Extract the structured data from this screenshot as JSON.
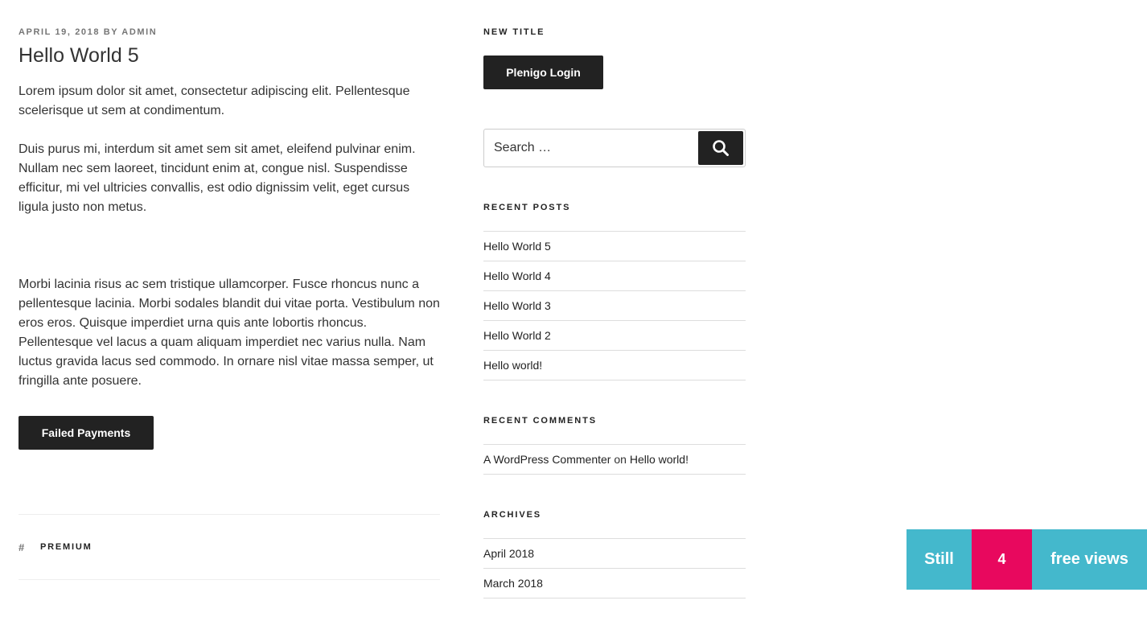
{
  "post": {
    "date": "APRIL 19, 2018",
    "by": "BY",
    "author": "ADMIN",
    "title": "Hello World 5",
    "paragraphs": [
      "Lorem ipsum dolor sit amet, consectetur adipiscing elit. Pellentesque scelerisque ut sem at condimentum.",
      "Duis purus mi, interdum sit amet sem sit amet, eleifend pulvinar enim. Nullam nec sem laoreet, tincidunt enim at, congue nisl. Suspendisse efficitur, mi vel ultricies convallis, est odio dignissim velit, eget cursus ligula justo non metus.",
      "Morbi lacinia risus ac sem tristique ullamcorper. Fusce rhoncus nunc a pellentesque lacinia. Morbi sodales blandit dui vitae porta. Vestibulum non eros eros. Quisque imperdiet urna quis ante lobortis rhoncus. Pellentesque vel lacus a quam aliquam imperdiet nec varius nulla. Nam luctus gravida lacus sed commodo. In ornare nisl vitae massa semper, ut fringilla ante posuere."
    ],
    "failed_payments_label": "Failed Payments",
    "tag_symbol": "#",
    "tag": "PREMIUM"
  },
  "sidebar": {
    "new_title": {
      "heading": "NEW TITLE",
      "login_label": "Plenigo Login"
    },
    "search": {
      "placeholder": "Search …",
      "icon": "search-icon"
    },
    "recent_posts": {
      "heading": "RECENT POSTS",
      "items": [
        "Hello World 5",
        "Hello World 4",
        "Hello World 3",
        "Hello World 2",
        "Hello world!"
      ]
    },
    "recent_comments": {
      "heading": "RECENT COMMENTS",
      "items": [
        {
          "author": "A WordPress Commenter",
          "on": "on",
          "post": "Hello world!"
        }
      ]
    },
    "archives": {
      "heading": "ARCHIVES",
      "items": [
        "April 2018",
        "March 2018"
      ]
    }
  },
  "views_banner": {
    "prefix": "Still",
    "count": "4",
    "suffix": "free views",
    "colors": {
      "teal": "#44b8cc",
      "pink": "#e8085e"
    }
  }
}
